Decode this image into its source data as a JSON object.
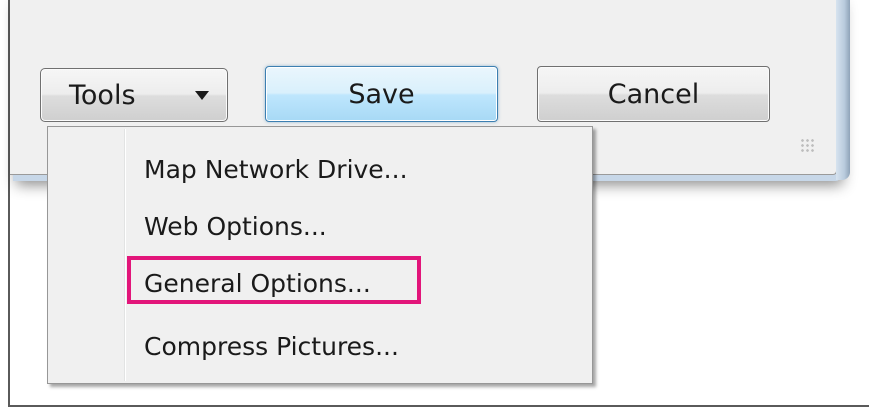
{
  "dialog": {
    "buttons": {
      "tools_label": "Tools",
      "save_label": "Save",
      "cancel_label": "Cancel"
    }
  },
  "tools_menu": {
    "items": [
      {
        "label": "Map Network Drive..."
      },
      {
        "label": "Web Options..."
      },
      {
        "label": "General Options...",
        "highlighted": true
      },
      {
        "label": "Compress Pictures..."
      }
    ]
  },
  "colors": {
    "highlight": "#e2157a",
    "default_button_border": "#3c7fb1",
    "menu_background": "#f0f0f0"
  },
  "icons": {
    "tools_dropdown": "caret-down-icon",
    "resize_grip": "resize-grip-icon"
  }
}
